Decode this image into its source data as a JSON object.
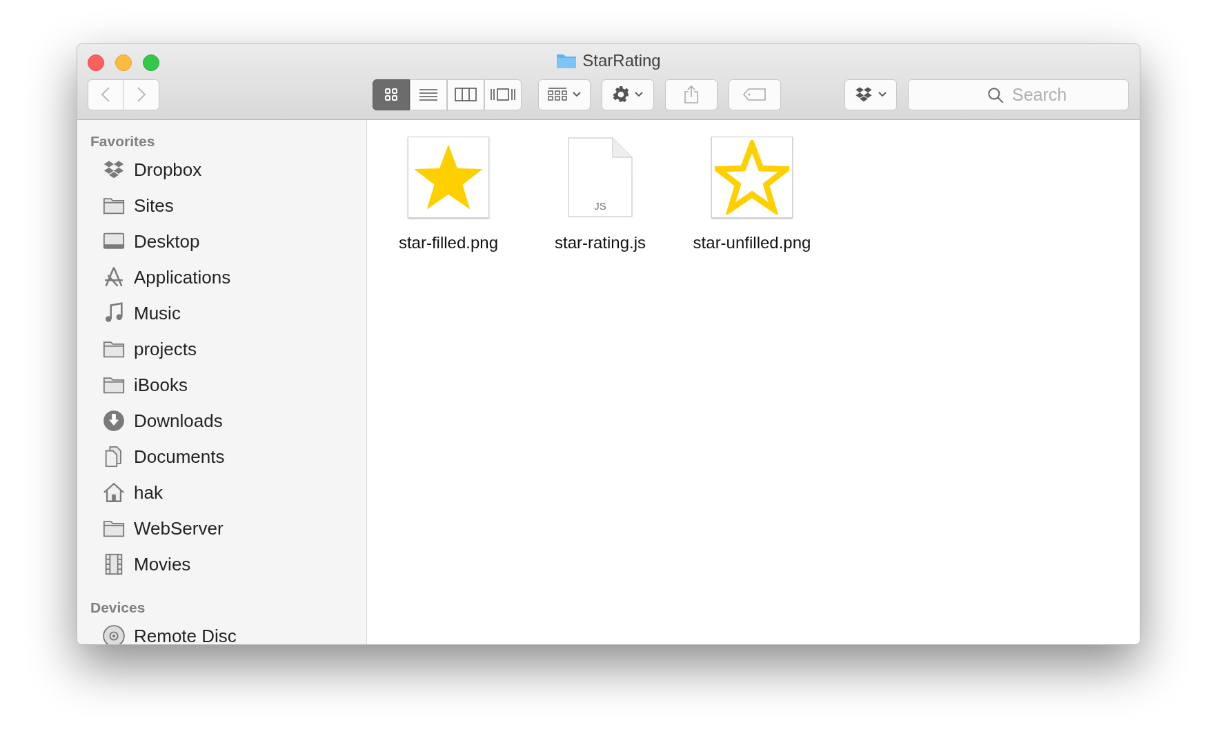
{
  "window": {
    "title": "StarRating"
  },
  "toolbar": {
    "view_modes": [
      {
        "kind": "icons",
        "selected": true
      },
      {
        "kind": "list",
        "selected": false
      },
      {
        "kind": "columns",
        "selected": false
      },
      {
        "kind": "coverflow",
        "selected": false
      }
    ],
    "search": {
      "placeholder": "Search"
    }
  },
  "sidebar": {
    "sections": [
      {
        "title": "Favorites",
        "items": [
          {
            "label": "Dropbox",
            "kind": "dropbox"
          },
          {
            "label": "Sites",
            "kind": "folder"
          },
          {
            "label": "Desktop",
            "kind": "desktop"
          },
          {
            "label": "Applications",
            "kind": "apps"
          },
          {
            "label": "Music",
            "kind": "music"
          },
          {
            "label": "projects",
            "kind": "folder"
          },
          {
            "label": "iBooks",
            "kind": "folder"
          },
          {
            "label": "Downloads",
            "kind": "download"
          },
          {
            "label": "Documents",
            "kind": "documents"
          },
          {
            "label": "hak",
            "kind": "home"
          },
          {
            "label": "WebServer",
            "kind": "folder"
          },
          {
            "label": "Movies",
            "kind": "movies"
          }
        ]
      },
      {
        "title": "Devices",
        "items": [
          {
            "label": "Remote Disc",
            "kind": "disc"
          }
        ]
      }
    ]
  },
  "files": [
    {
      "name": "star-filled.png",
      "kind": "star-filled"
    },
    {
      "name": "star-rating.js",
      "kind": "script",
      "badge": "JS"
    },
    {
      "name": "star-unfilled.png",
      "kind": "star-outline"
    }
  ]
}
